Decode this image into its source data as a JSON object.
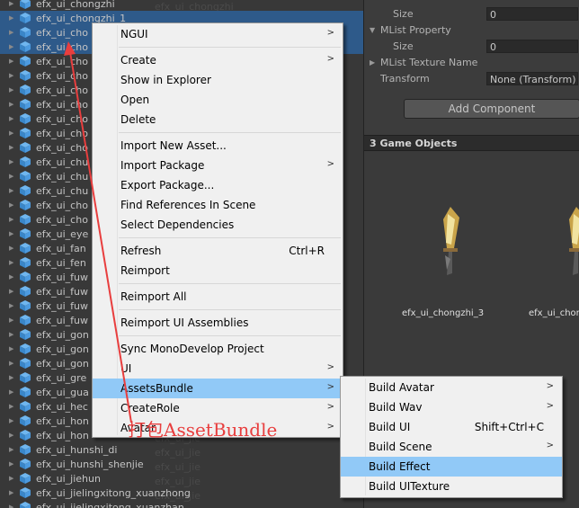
{
  "project_list": {
    "ghost_items": [
      "efx_ui_chongzhi",
      "efx_ui_chongzhi",
      "efx_ui_chongzhi",
      "efx_ui_chongzhi",
      "efx_ui_chuang",
      "efx_ui_chuang",
      "efx_ui_fenji",
      "efx_ui_fenji",
      "efx_ui_fuwen",
      "efx_ui_fuwen",
      "efx_ui_fuwen",
      "efx_ui_fuwen",
      "efx_ui_gong",
      "efx_ui_gong",
      "efx_ui_gong",
      "efx_ui_gong",
      "efx_ui_guang",
      "efx_ui_guang",
      "efx_ui_hong",
      "efx_ui_hong",
      "efx_ui_hong",
      "efx_ui_hong",
      "efx_ui_hong",
      "efx_ui_hunshi",
      "efx_ui_hunshi",
      "efx_ui_hunshi",
      "efx_ui_jie",
      "efx_ui_jie",
      "efx_ui_jie",
      "efx_ui_jie",
      "efx_ui_jie",
      "efx_ui_jie",
      "efx_ui_jie",
      "efx_ui_jie",
      "efx_ui_jie"
    ],
    "items": [
      {
        "name": "efx_ui_chongzhi",
        "selected": false
      },
      {
        "name": "efx_ui_chongzhi_1",
        "selected": true
      },
      {
        "name": "efx_ui_cho",
        "selected": true
      },
      {
        "name": "efx_ui_cho",
        "selected": true
      },
      {
        "name": "efx_ui_cho",
        "selected": false
      },
      {
        "name": "efx_ui_cho",
        "selected": false
      },
      {
        "name": "efx_ui_cho",
        "selected": false
      },
      {
        "name": "efx_ui_cho",
        "selected": false
      },
      {
        "name": "efx_ui_cho",
        "selected": false
      },
      {
        "name": "efx_ui_cho",
        "selected": false
      },
      {
        "name": "efx_ui_cho",
        "selected": false
      },
      {
        "name": "efx_ui_chu",
        "selected": false
      },
      {
        "name": "efx_ui_chu",
        "selected": false
      },
      {
        "name": "efx_ui_chu",
        "selected": false
      },
      {
        "name": "efx_ui_cho",
        "selected": false
      },
      {
        "name": "efx_ui_cho",
        "selected": false
      },
      {
        "name": "efx_ui_eye",
        "selected": false
      },
      {
        "name": "efx_ui_fan",
        "selected": false
      },
      {
        "name": "efx_ui_fen",
        "selected": false
      },
      {
        "name": "efx_ui_fuw",
        "selected": false
      },
      {
        "name": "efx_ui_fuw",
        "selected": false
      },
      {
        "name": "efx_ui_fuw",
        "selected": false
      },
      {
        "name": "efx_ui_fuw",
        "selected": false
      },
      {
        "name": "efx_ui_gon",
        "selected": false
      },
      {
        "name": "efx_ui_gon",
        "selected": false
      },
      {
        "name": "efx_ui_gon",
        "selected": false
      },
      {
        "name": "efx_ui_gre",
        "selected": false
      },
      {
        "name": "efx_ui_gua",
        "selected": false
      },
      {
        "name": "efx_ui_hec",
        "selected": false
      },
      {
        "name": "efx_ui_hon",
        "selected": false
      },
      {
        "name": "efx_ui_hon",
        "selected": false
      },
      {
        "name": "efx_ui_hunshi_di",
        "selected": false
      },
      {
        "name": "efx_ui_hunshi_shenjie",
        "selected": false
      },
      {
        "name": "efx_ui_jiehun",
        "selected": false
      },
      {
        "name": "efx_ui_jielingxitong_xuanzhong",
        "selected": false
      },
      {
        "name": "efx_ui_jielingxitong_xuanzhan",
        "selected": false
      }
    ]
  },
  "inspector": {
    "size_label_1": "Size",
    "size_value_1": "0",
    "mlist_property": "MList Property",
    "size_label_2": "Size",
    "size_value_2": "0",
    "mlist_texture_name": "MList Texture Name",
    "transform_label": "Transform",
    "transform_value": "None (Transform)",
    "add_component": "Add Component",
    "objects_header": "3 Game Objects",
    "preview_labels": [
      "efx_ui_chongzhi_3",
      "efx_ui_chor"
    ]
  },
  "context_menu": {
    "items": [
      {
        "label": "NGUI",
        "submenu": true
      },
      {
        "label": "Create",
        "submenu": true
      },
      {
        "label": "Show in Explorer"
      },
      {
        "label": "Open"
      },
      {
        "label": "Delete"
      },
      {
        "label": "Import New Asset..."
      },
      {
        "label": "Import Package",
        "submenu": true
      },
      {
        "label": "Export Package..."
      },
      {
        "label": "Find References In Scene"
      },
      {
        "label": "Select Dependencies"
      },
      {
        "label": "Refresh",
        "shortcut": "Ctrl+R"
      },
      {
        "label": "Reimport"
      },
      {
        "label": "Reimport All"
      },
      {
        "label": "Reimport UI Assemblies"
      },
      {
        "label": "Sync MonoDevelop Project"
      },
      {
        "label": "UI",
        "submenu": true
      },
      {
        "label": "AssetsBundle",
        "submenu": true,
        "highlight": true
      },
      {
        "label": "CreateRole",
        "submenu": true
      },
      {
        "label": "Avatar",
        "submenu": true
      }
    ]
  },
  "submenu": {
    "items": [
      {
        "label": "Build Avatar",
        "submenu": true
      },
      {
        "label": "Build Wav",
        "submenu": true
      },
      {
        "label": "Build UI",
        "shortcut": "Shift+Ctrl+C"
      },
      {
        "label": "Build Scene",
        "submenu": true
      },
      {
        "label": "Build Effect",
        "highlight": true
      },
      {
        "label": "Build UITexture"
      }
    ]
  },
  "annotation": {
    "text": "打包AssetBundle",
    "color": "#e83e3e"
  },
  "colors": {
    "highlight": "#91c9f7",
    "selection": "#2e5a8a",
    "panel": "#383838"
  }
}
